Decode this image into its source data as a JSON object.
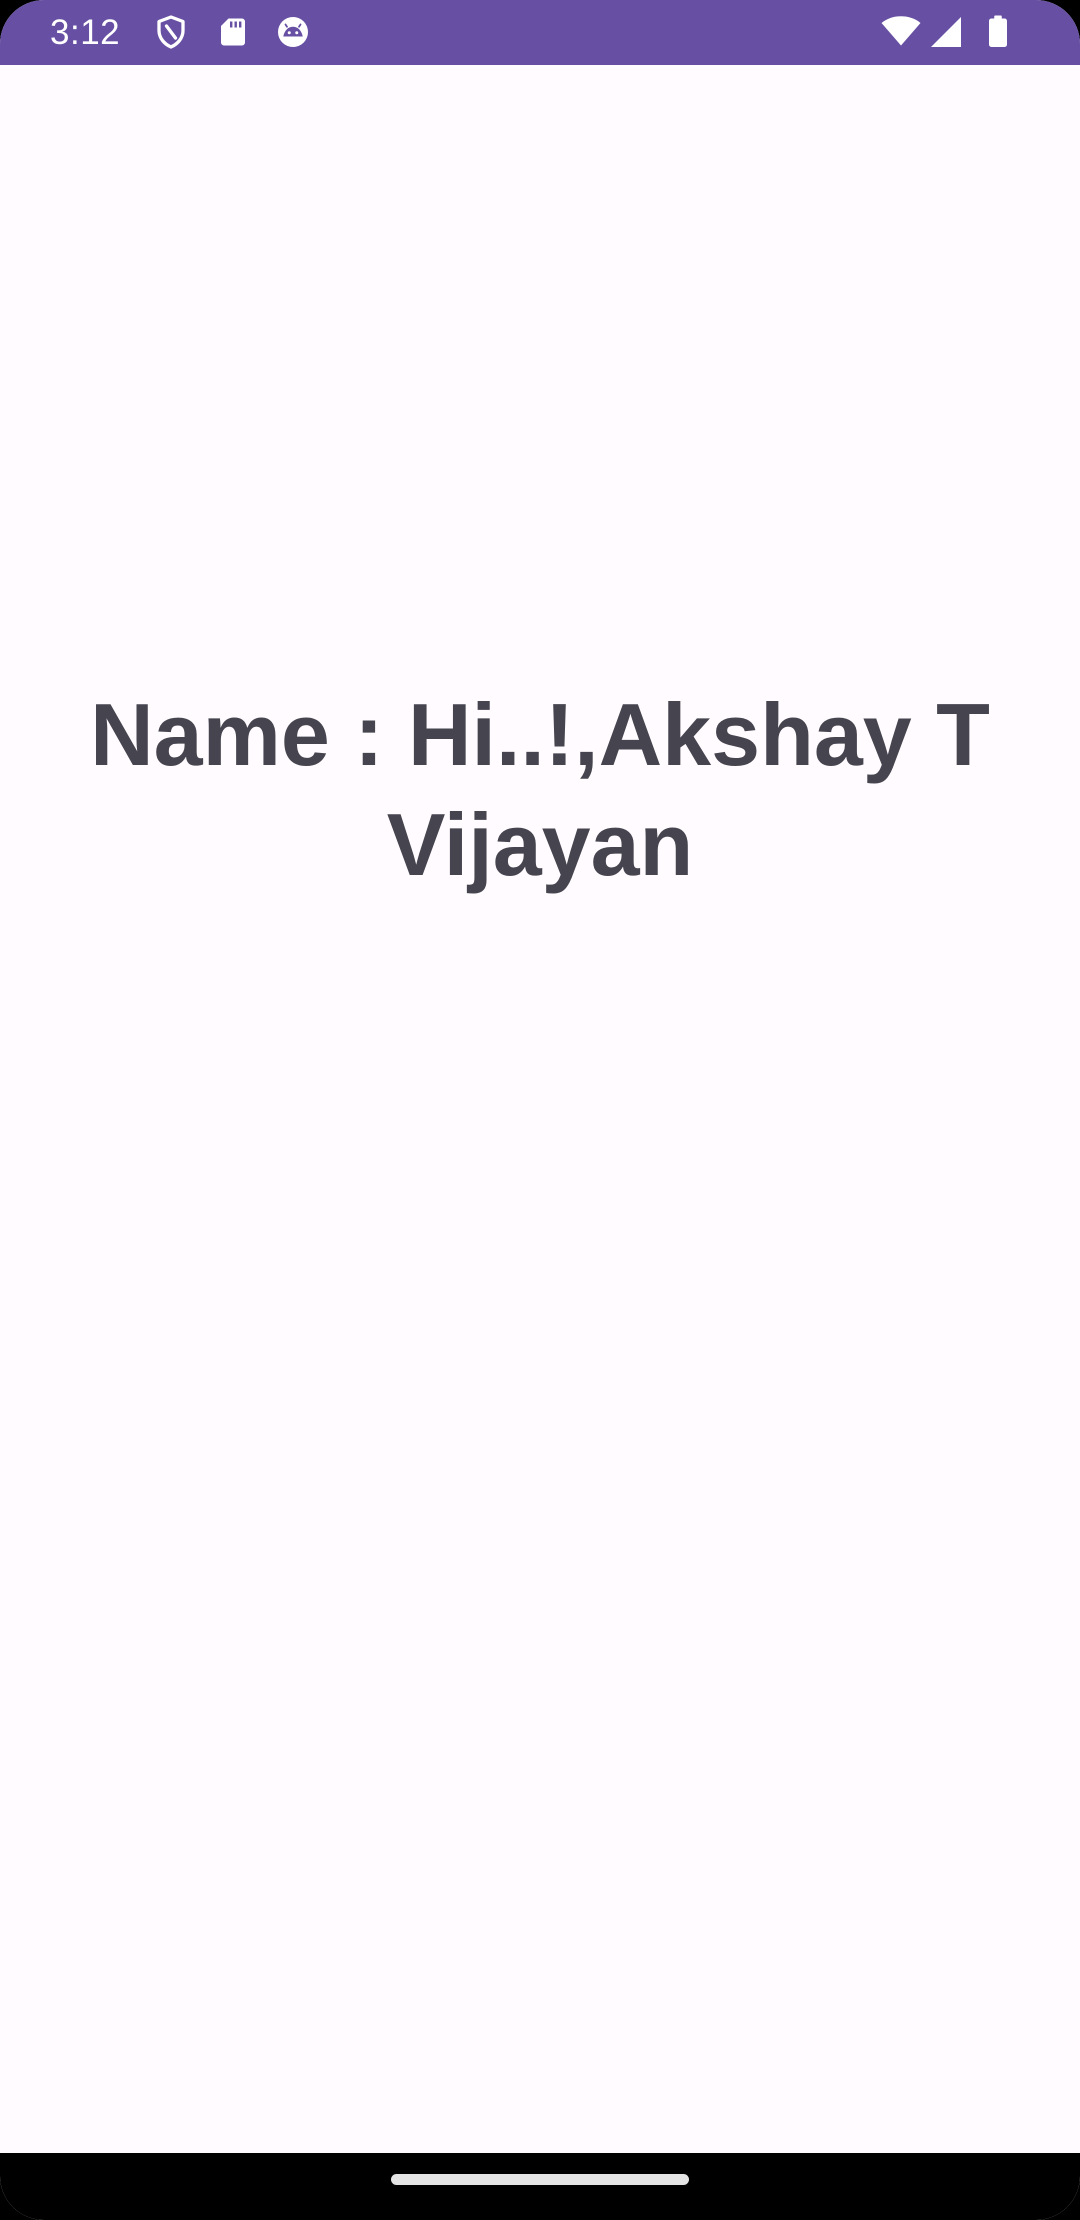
{
  "status_bar": {
    "time": "3:12",
    "background": "#6750A4",
    "left_icons": [
      "shield-icon",
      "sd-card-icon",
      "android-face-icon"
    ],
    "right_icons": [
      "wifi-icon",
      "cellular-signal-icon",
      "battery-icon"
    ]
  },
  "main": {
    "name_text": "Name : Hi..!,Akshay T Vijayan",
    "text_color": "#46444F",
    "background": "#FFFBFE"
  },
  "nav_bar": {
    "background": "#000000"
  }
}
